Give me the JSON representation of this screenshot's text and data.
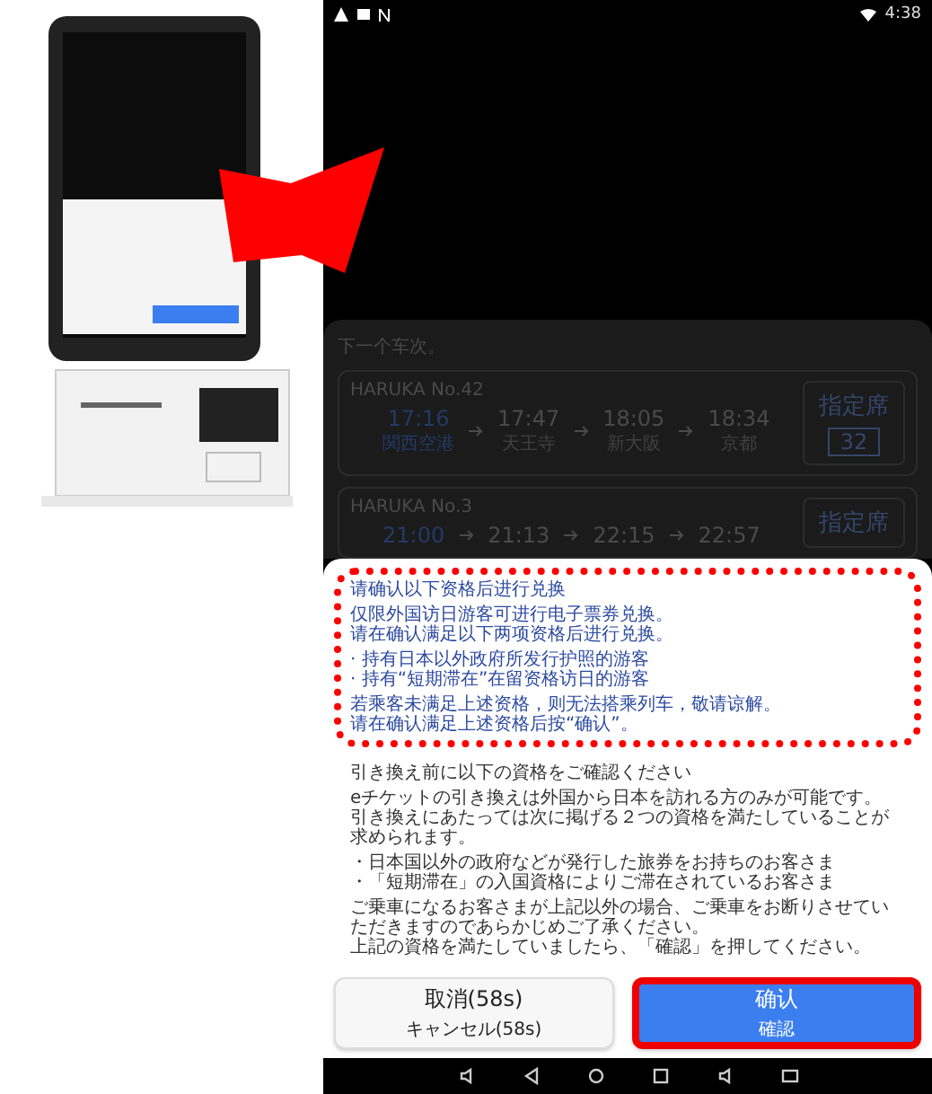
{
  "status_bar": {
    "time": "4:38"
  },
  "background_list": {
    "heading": "下一个车次。",
    "trains": [
      {
        "name": "HARUKA No.42",
        "stops": [
          {
            "time": "17:16",
            "station": "関西空港"
          },
          {
            "time": "17:47",
            "station": "天王寺"
          },
          {
            "time": "18:05",
            "station": "新大阪"
          },
          {
            "time": "18:34",
            "station": "京都"
          }
        ],
        "seat_type": "指定席",
        "car": "32"
      },
      {
        "name": "HARUKA No.3",
        "stops": [
          {
            "time": "21:00"
          },
          {
            "time": "21:13"
          },
          {
            "time": "22:15"
          },
          {
            "time": "22:57"
          }
        ],
        "seat_type": "指定席"
      }
    ]
  },
  "dialog": {
    "notice_zh": {
      "annotated": true,
      "paragraphs": [
        [
          "请确认以下资格后进行兑换"
        ],
        [
          "仅限外国访日游客可进行电子票券兑换。",
          "请在确认满足以下两项资格后进行兑换。"
        ],
        [
          "· 持有日本以外政府所发行护照的游客",
          "· 持有“短期滞在”在留资格访日的游客"
        ],
        [
          "若乘客未满足上述资格，则无法搭乘列车，敬请谅解。",
          "请在确认满足上述资格后按“确认”。"
        ]
      ]
    },
    "notice_ja": {
      "paragraphs": [
        [
          "引き換え前に以下の資格をご確認ください"
        ],
        [
          "eチケットの引き換えは外国から日本を訪れる方のみが可能です。",
          "引き換えにあたっては次に掲げる２つの資格を満たしていることが求められます。"
        ],
        [
          "・日本国以外の政府などが発行した旅券をお持ちのお客さま",
          "・「短期滞在」の入国資格によりご滞在されているお客さま"
        ],
        [
          "ご乗車になるお客さまが上記以外の場合、ご乗車をお断りさせていただきますのであらかじめご了承ください。",
          "上記の資格を満たしていましたら、「確認」を押してください。"
        ]
      ]
    },
    "buttons": [
      {
        "kind": "cancel",
        "label": "取消(58s)",
        "sublabel": "キャンセル(58s)",
        "highlighted": false
      },
      {
        "kind": "confirm",
        "label": "确认",
        "sublabel": "確認",
        "highlighted": true
      }
    ]
  }
}
